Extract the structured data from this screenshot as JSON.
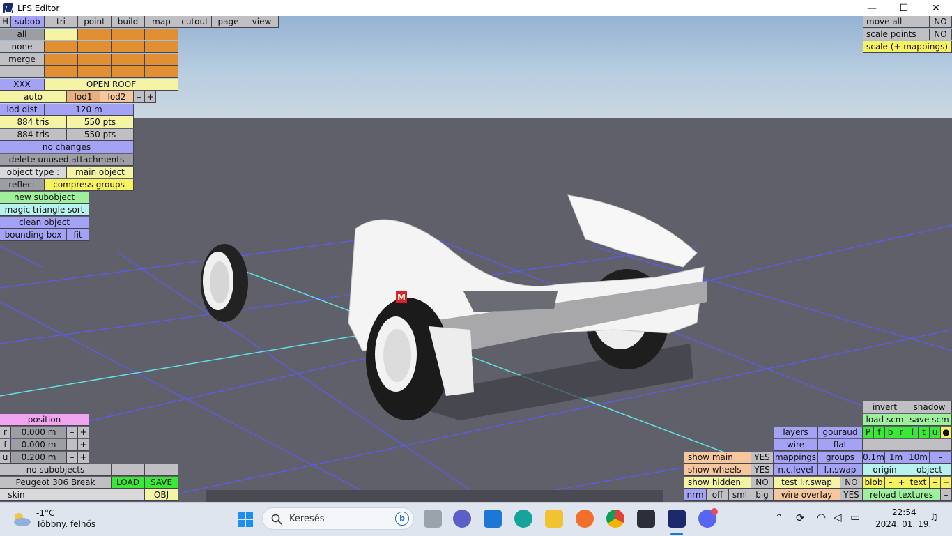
{
  "window": {
    "title": "LFS Editor",
    "minimize": "—",
    "maximize": "☐",
    "close": "✕"
  },
  "menu": {
    "h": "H",
    "items": [
      "subob",
      "tri",
      "point",
      "build",
      "map",
      "cutout",
      "page",
      "view"
    ]
  },
  "subob_panel": {
    "all": "all",
    "none": "none",
    "merge": "merge",
    "dash": "–",
    "xxx": "XXX",
    "open_roof": "OPEN ROOF",
    "auto": "auto",
    "lod1": "lod1",
    "lod2": "lod2",
    "minus": "–",
    "plus": "+",
    "lod_dist_label": "lod dist",
    "lod_dist_value": "120 m",
    "tris1": "884 tris",
    "pts1": "550 pts",
    "tris2": "884 tris",
    "pts2": "550 pts",
    "no_changes": "no changes",
    "delete_unused": "delete unused attachments",
    "object_type_label": "object type :",
    "object_type_value": "main object",
    "reflect": "reflect",
    "compress_groups": "compress groups",
    "new_subobject": "new subobject",
    "magic_triangle_sort": "magic triangle sort",
    "clean_object": "clean object",
    "bounding_box": "bounding box",
    "fit": "fit"
  },
  "top_right": {
    "move_all": "move all",
    "move_all_val": "NO",
    "scale_points": "scale points",
    "scale_points_val": "NO",
    "scale_mappings": "scale (+ mappings)"
  },
  "position_panel": {
    "title": "position",
    "rows": [
      {
        "axis": "r",
        "value": "0.000 m"
      },
      {
        "axis": "f",
        "value": "0.000 m"
      },
      {
        "axis": "u",
        "value": "0.200 m"
      }
    ],
    "minus": "–",
    "plus": "+",
    "no_subobjects": "no subobjects",
    "car_name": "Peugeot 306 Break",
    "load": "LOAD",
    "save": "SAVE",
    "skin": "skin",
    "obj": "OBJ"
  },
  "bottom_right": {
    "invert": "invert",
    "shadow": "shadow",
    "load_scm": "load scm",
    "save_scm": "save scm",
    "layers": "layers",
    "gouraud": "gouraud",
    "wire": "wire",
    "flat": "flat",
    "layer_letters": [
      "P",
      "f",
      "b",
      "r",
      "l",
      "t",
      "u",
      "●"
    ],
    "show_main": "show main",
    "show_main_val": "YES",
    "mappings": "mappings",
    "groups": "groups",
    "step_01": "0.1m",
    "step_1": "1m",
    "step_10": "10m",
    "step_minus": "–",
    "show_wheels": "show wheels",
    "show_wheels_val": "YES",
    "nc_level": "n.c.level",
    "lr_swap": "l.r.swap",
    "origin": "origin",
    "object": "object",
    "show_hidden": "show hidden",
    "show_hidden_val": "NO",
    "test_lr_swap": "test l.r.swap",
    "test_lr_swap_val": "NO",
    "blob": "blob",
    "text": "text",
    "nrm": "nrm",
    "off": "off",
    "sml": "sml",
    "big": "big",
    "wire_overlay": "wire overlay",
    "wire_overlay_val": "YES",
    "reload_textures": "reload textures",
    "dash": "–",
    "plus": "+"
  },
  "decal_mark": "M",
  "taskbar": {
    "weather_temp": "-1°C",
    "weather_desc": "Többny. felhős",
    "search_placeholder": "Keresés",
    "time": "22:54",
    "date": "2024. 01. 19."
  }
}
